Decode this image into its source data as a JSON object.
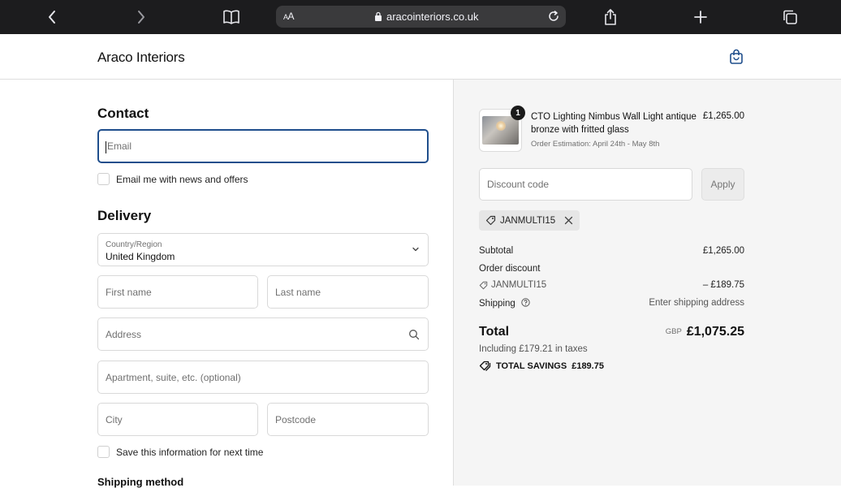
{
  "browser": {
    "url_display": "aracointeriors.co.uk",
    "aa_small": "A",
    "aa_large": "A"
  },
  "header": {
    "brand": "Araco Interiors"
  },
  "contact": {
    "title": "Contact",
    "email_placeholder": "Email",
    "newsletter_label": "Email me with news and offers"
  },
  "delivery": {
    "title": "Delivery",
    "country_label": "Country/Region",
    "country_value": "United Kingdom",
    "first_name_placeholder": "First name",
    "last_name_placeholder": "Last name",
    "address_placeholder": "Address",
    "apartment_placeholder": "Apartment, suite, etc. (optional)",
    "city_placeholder": "City",
    "postcode_placeholder": "Postcode",
    "save_info_label": "Save this information for next time"
  },
  "shipping_method": {
    "title": "Shipping method"
  },
  "summary": {
    "product": {
      "quantity": "1",
      "title": "CTO Lighting Nimbus Wall Light antique bronze with fritted glass",
      "estimation": "Order Estimation: April 24th - May 8th",
      "price": "£1,265.00"
    },
    "discount_placeholder": "Discount code",
    "apply_label": "Apply",
    "applied_code": "JANMULTI15",
    "subtotal_label": "Subtotal",
    "subtotal_value": "£1,265.00",
    "order_discount_label": "Order discount",
    "discount_code": "JANMULTI15",
    "discount_value": "– £189.75",
    "shipping_label": "Shipping",
    "shipping_value": "Enter shipping address",
    "total_label": "Total",
    "currency": "GBP",
    "total_value": "£1,075.25",
    "taxes_note": "Including £179.21 in taxes",
    "savings_label": "TOTAL SAVINGS",
    "savings_value": "£189.75"
  },
  "colors": {
    "focus_border": "#1f4e8c",
    "summary_background": "#f5f5f5",
    "browser_chrome": "#1c1c1e"
  }
}
